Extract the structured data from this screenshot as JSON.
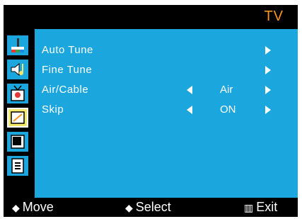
{
  "header": {
    "title": "TV"
  },
  "sidebar": {
    "icons": [
      "picture-icon",
      "sound-icon",
      "setup-icon",
      "tv-icon",
      "pip-icon",
      "info-icon"
    ],
    "selected_index": 3
  },
  "menu": {
    "rows": [
      {
        "label": "Auto Tune"
      },
      {
        "label": "Fine Tune"
      },
      {
        "label": "Air/Cable",
        "value": "Air"
      },
      {
        "label": "Skip",
        "value": "ON"
      }
    ]
  },
  "footer": {
    "move_symbol": "◆",
    "move_label": "Move",
    "select_symbol": "◆",
    "select_label": "Select",
    "exit_symbol": "▥",
    "exit_label": "Exit"
  },
  "colors": {
    "background": "#1ba6de",
    "accent": "#f7941d",
    "frame": "#000000"
  }
}
